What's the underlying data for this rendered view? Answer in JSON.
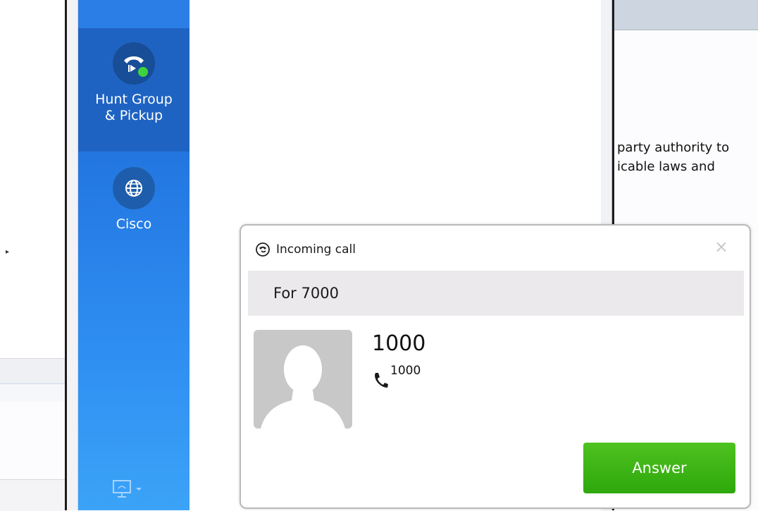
{
  "sidebar": {
    "items": [
      {
        "label_line1": "Hunt Group",
        "label_line2": "& Pickup",
        "icon": "hunt-group-icon"
      },
      {
        "label_line1": "Cisco",
        "icon": "globe-icon"
      }
    ]
  },
  "document": {
    "text": "party authority to\nicable laws and"
  },
  "popup": {
    "title": "Incoming call",
    "for_line": "For 7000",
    "caller_name": "1000",
    "caller_number": "1000",
    "answer_label": "Answer",
    "close_label": "×"
  },
  "colors": {
    "sidebar_top": "#1d62c8",
    "sidebar_bottom": "#3ba3f7",
    "answer_green": "#36b012",
    "presence_green": "#3ed33e"
  }
}
